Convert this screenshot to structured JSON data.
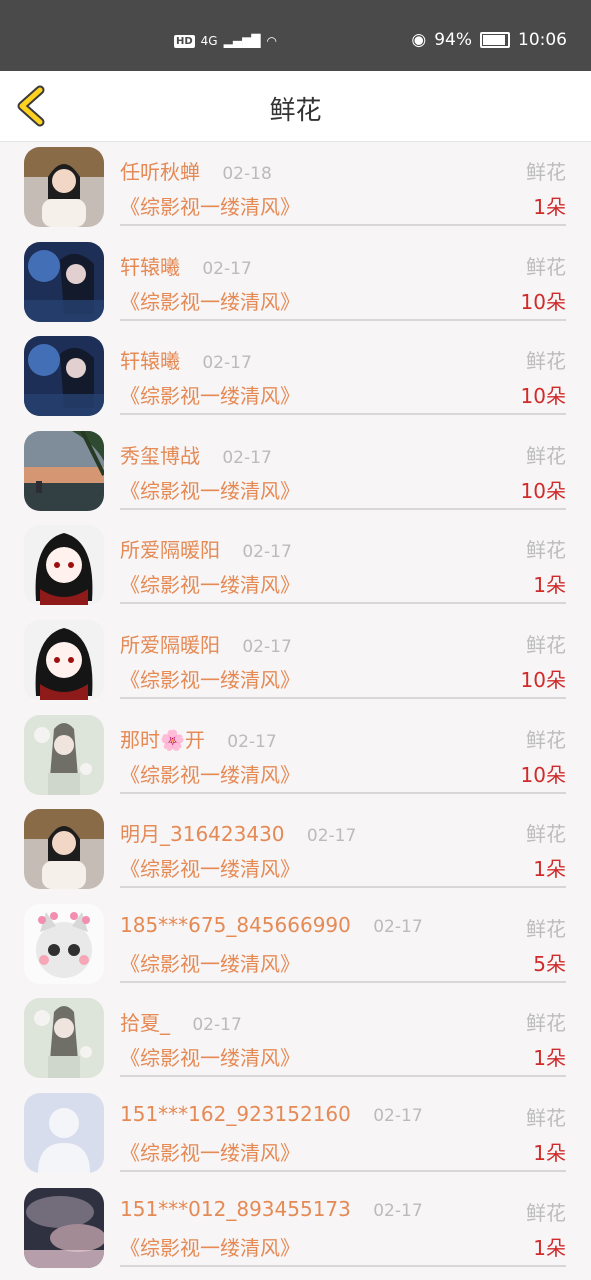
{
  "status_bar": {
    "hd": "HD",
    "network": "4G",
    "battery": "94%",
    "time": "10:06"
  },
  "header": {
    "title": "鲜花"
  },
  "gift_records": [
    {
      "name": "任听秋蝉",
      "date": "02-18",
      "gift": "鲜花",
      "work": "《综影视一缕清风》",
      "count": "1朵",
      "avatar": "woman-portrait"
    },
    {
      "name": "轩辕曦",
      "date": "02-17",
      "gift": "鲜花",
      "work": "《综影视一缕清风》",
      "count": "10朵",
      "avatar": "fantasy-art"
    },
    {
      "name": "轩辕曦",
      "date": "02-17",
      "gift": "鲜花",
      "work": "《综影视一缕清风》",
      "count": "10朵",
      "avatar": "fantasy-art"
    },
    {
      "name": "秀玺博战",
      "date": "02-17",
      "gift": "鲜花",
      "work": "《综影视一缕清风》",
      "count": "10朵",
      "avatar": "sunset-beach"
    },
    {
      "name": "所爱隔暖阳",
      "date": "02-17",
      "gift": "鲜花",
      "work": "《综影视一缕清风》",
      "count": "1朵",
      "avatar": "anime-character"
    },
    {
      "name": "所爱隔暖阳",
      "date": "02-17",
      "gift": "鲜花",
      "work": "《综影视一缕清风》",
      "count": "10朵",
      "avatar": "anime-character"
    },
    {
      "name": "那时🌸开",
      "date": "02-17",
      "gift": "鲜花",
      "work": "《综影视一缕清风》",
      "count": "10朵",
      "avatar": "flower-girl"
    },
    {
      "name": "明月_316423430",
      "date": "02-17",
      "gift": "鲜花",
      "work": "《综影视一缕清风》",
      "count": "1朵",
      "avatar": "woman-portrait"
    },
    {
      "name": "185***675_845666990",
      "date": "02-17",
      "gift": "鲜花",
      "work": "《综影视一缕清风》",
      "count": "5朵",
      "avatar": "cat"
    },
    {
      "name": "拾夏_",
      "date": "02-17",
      "gift": "鲜花",
      "work": "《综影视一缕清风》",
      "count": "1朵",
      "avatar": "flower-girl"
    },
    {
      "name": "151***162_923152160",
      "date": "02-17",
      "gift": "鲜花",
      "work": "《综影视一缕清风》",
      "count": "1朵",
      "avatar": "default-user"
    },
    {
      "name": "151***012_893455173",
      "date": "02-17",
      "gift": "鲜花",
      "work": "《综影视一缕清风》",
      "count": "1朵",
      "avatar": "cloudy-sky"
    }
  ]
}
